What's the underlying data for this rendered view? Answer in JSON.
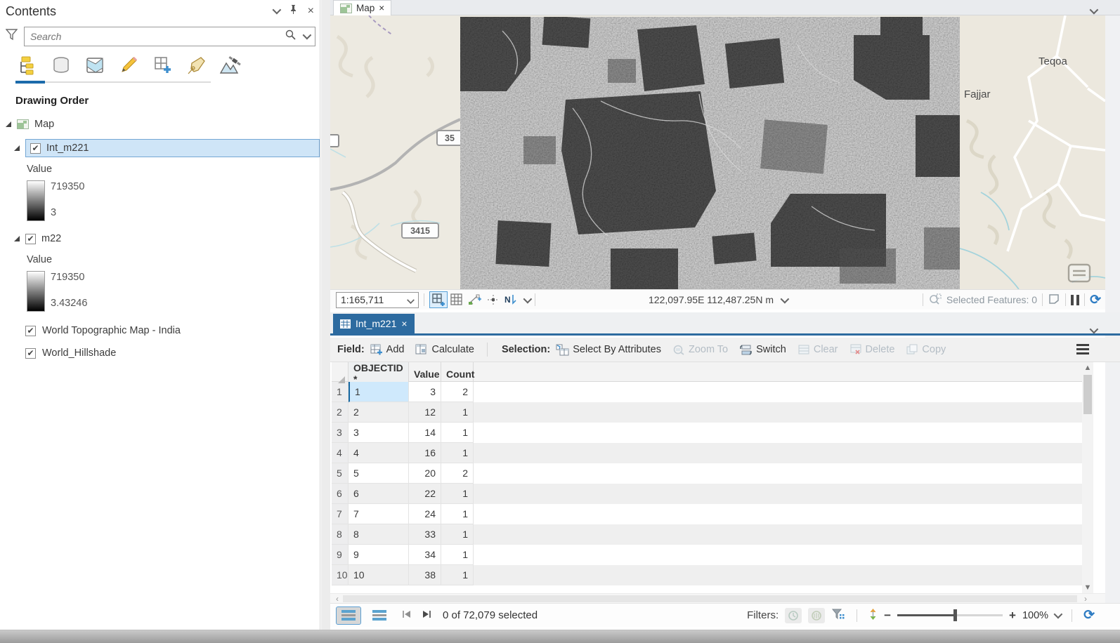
{
  "contents_panel": {
    "title": "Contents",
    "search_placeholder": "Search",
    "drawing_order_label": "Drawing Order",
    "layers": [
      {
        "name": "Map"
      },
      {
        "name": "Int_m221",
        "legend_field": "Value",
        "max": "719350",
        "min": "3"
      },
      {
        "name": "m22",
        "legend_field": "Value",
        "max": "719350",
        "min": "3.43246"
      },
      {
        "name": "World Topographic Map - India"
      },
      {
        "name": "World_Hillshade"
      }
    ]
  },
  "map_view": {
    "tab_label": "Map",
    "scale": "1:165,711",
    "coordinates": "122,097.95E 112,487.25N m",
    "selected_features_label": "Selected Features: 0",
    "labels": {
      "place_top_right": "Teqoa",
      "place_mid_right": "Fajjar",
      "road_shield_1": "35",
      "road_shield_2": "3415"
    }
  },
  "table_pane": {
    "tab_label": "Int_m221",
    "toolbar": {
      "field_label": "Field:",
      "add": "Add",
      "calculate": "Calculate",
      "selection_label": "Selection:",
      "select_by_attributes": "Select By Attributes",
      "zoom_to": "Zoom To",
      "switch": "Switch",
      "clear": "Clear",
      "delete": "Delete",
      "copy": "Copy"
    },
    "columns": {
      "objectid": "OBJECTID *",
      "value": "Value",
      "count": "Count"
    },
    "rows": [
      [
        "1",
        "1",
        "3",
        "2"
      ],
      [
        "2",
        "2",
        "12",
        "1"
      ],
      [
        "3",
        "3",
        "14",
        "1"
      ],
      [
        "4",
        "4",
        "16",
        "1"
      ],
      [
        "5",
        "5",
        "20",
        "2"
      ],
      [
        "6",
        "6",
        "22",
        "1"
      ],
      [
        "7",
        "7",
        "24",
        "1"
      ],
      [
        "8",
        "8",
        "33",
        "1"
      ],
      [
        "9",
        "9",
        "34",
        "1"
      ],
      [
        "10",
        "10",
        "38",
        "1"
      ]
    ],
    "status": "0 of 72,079 selected",
    "filters_label": "Filters:",
    "zoom_value": "100%"
  },
  "icons": {
    "close": "×",
    "pin": "⊤",
    "check": "✔",
    "minus": "−",
    "plus": "+",
    "chevron_left": "‹",
    "chevron_right": "›",
    "up_arrow": "▲",
    "down_arrow": "▼",
    "refresh": "⟳"
  },
  "colors": {
    "accent_blue": "#2d6ba0",
    "selection_blue": "#cfe5f7",
    "header_underline": "#1a6ca8"
  }
}
